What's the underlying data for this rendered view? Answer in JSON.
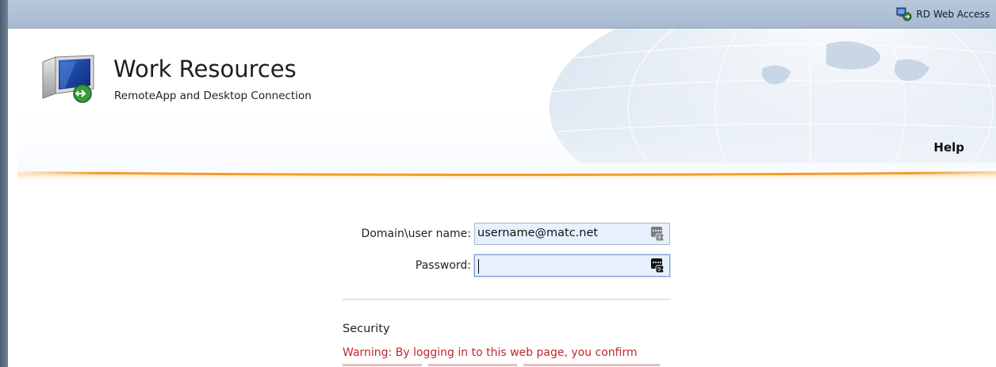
{
  "top_bar": {
    "rd_web_access_label": "RD Web Access",
    "icon": "rd-web-access-icon"
  },
  "header": {
    "title": "Work Resources",
    "subtitle": "RemoteApp and Desktop Connection",
    "logo_icon": "remote-desktop-computer-icon",
    "help_label": "Help"
  },
  "login": {
    "username_label": "Domain\\user name:",
    "username_value": "username@matc.net",
    "password_label": "Password:",
    "password_value": "",
    "field_icon": "keyboard-icon"
  },
  "security": {
    "heading": "Security",
    "warning_text": "Warning: By logging in to this web page, you confirm"
  },
  "colors": {
    "accent_orange": "#f39a2e",
    "warning_red": "#c0282d",
    "top_strip": "#b2c2d8"
  }
}
